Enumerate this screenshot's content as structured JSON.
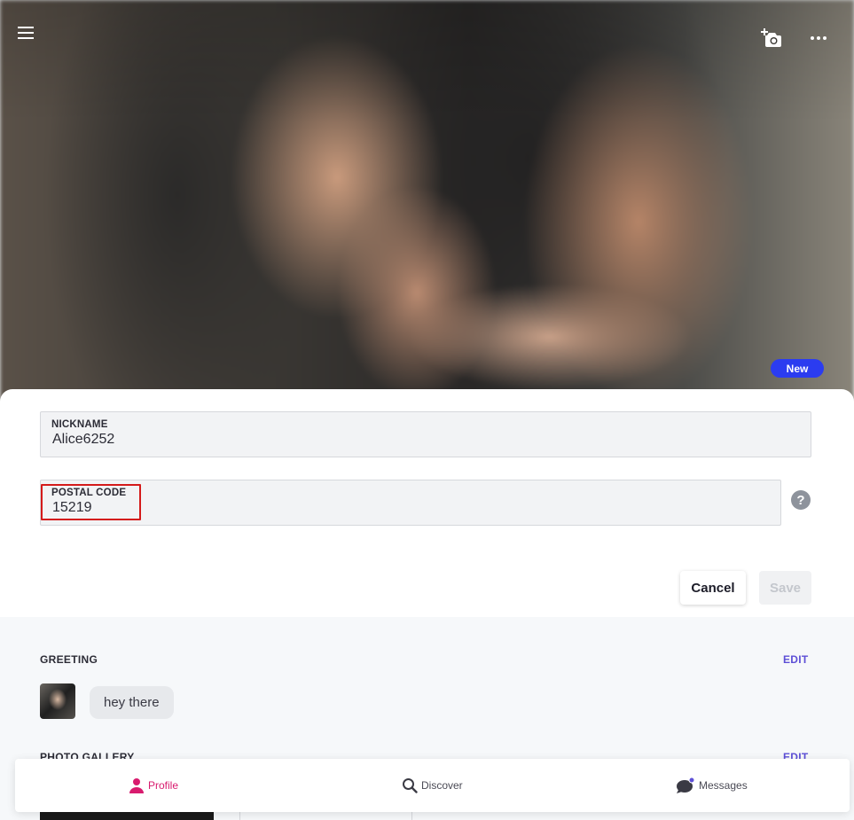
{
  "hero": {
    "badge": "New"
  },
  "form": {
    "nickname_label": "NICKNAME",
    "nickname_value": "Alice6252",
    "postal_label": "POSTAL CODE",
    "postal_value": "15219",
    "help_glyph": "?",
    "cancel_label": "Cancel",
    "save_label": "Save"
  },
  "greeting": {
    "title": "GREETING",
    "edit_label": "EDIT",
    "message": "hey there"
  },
  "gallery": {
    "title": "PHOTO GALLERY",
    "edit_label": "EDIT"
  },
  "nav": {
    "items": [
      {
        "label": "Profile",
        "icon": "person-icon",
        "active": true
      },
      {
        "label": "Discover",
        "icon": "search-icon",
        "active": false
      },
      {
        "label": "Messages",
        "icon": "chat-bubble-icon",
        "active": false
      }
    ]
  },
  "colors": {
    "accent": "#d81b6e",
    "badge": "#2b3cf0",
    "edit_link": "#5d4fd6",
    "highlight": "#d41a1a"
  }
}
